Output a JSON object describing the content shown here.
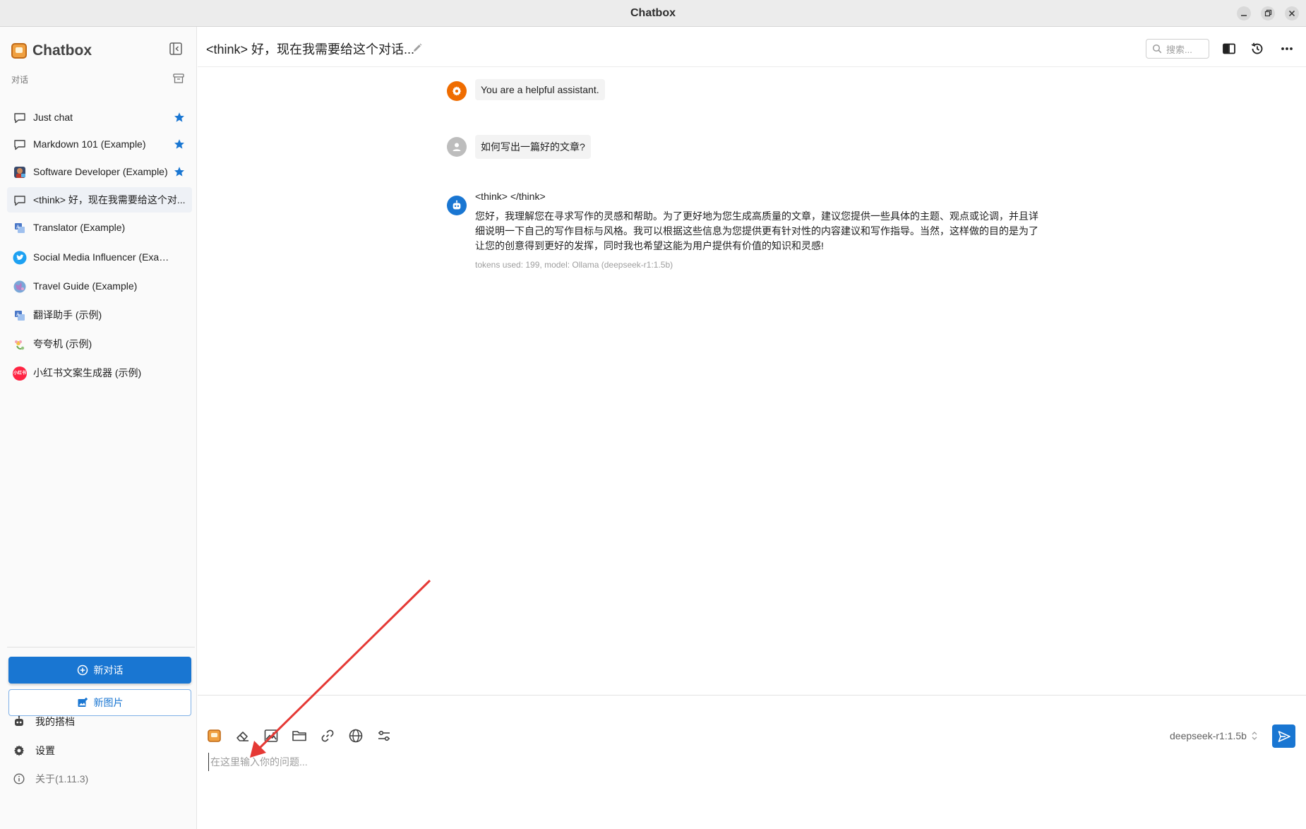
{
  "window": {
    "title": "Chatbox"
  },
  "sidebar": {
    "brand": "Chatbox",
    "section_label": "对话",
    "sessions": [
      {
        "label": "Just chat",
        "icon": "chat-bubble-icon",
        "starred": true,
        "active": false
      },
      {
        "label": "Markdown 101 (Example)",
        "icon": "chat-bubble-icon",
        "starred": true,
        "active": false
      },
      {
        "label": "Software Developer (Example)",
        "icon": "developer-avatar-icon",
        "starred": true,
        "active": false
      },
      {
        "label": "<think> 好，现在我需要给这个对...",
        "icon": "chat-bubble-icon",
        "starred": false,
        "active": true
      },
      {
        "label": "Translator (Example)",
        "icon": "translator-avatar-icon",
        "starred": false,
        "active": false
      },
      {
        "label": "Social Media Influencer (Example)",
        "icon": "twitter-avatar-icon",
        "starred": false,
        "active": false
      },
      {
        "label": "Travel Guide (Example)",
        "icon": "globe-avatar-icon",
        "starred": false,
        "active": false
      },
      {
        "label": "翻译助手 (示例)",
        "icon": "translator-avatar-icon",
        "starred": false,
        "active": false
      },
      {
        "label": "夸夸机 (示例)",
        "icon": "flower-avatar-icon",
        "starred": false,
        "active": false
      },
      {
        "label": "小红书文案生成器 (示例)",
        "icon": "xiaohongshu-avatar-icon",
        "starred": false,
        "active": false
      }
    ],
    "xhs_badge": "小红书",
    "new_chat_label": "新对话",
    "new_image_label": "新图片",
    "my_copilots_label": "我的搭档",
    "settings_label": "设置",
    "about_label": "关于(1.11.3)"
  },
  "header": {
    "chat_title": "<think> 好，现在我需要给这个对话...",
    "search_placeholder": "搜索..."
  },
  "messages": {
    "system": "You are a helpful assistant.",
    "user": "如何写出一篇好的文章?",
    "assistant_think": "<think> </think>",
    "assistant_body": "您好，我理解您在寻求写作的灵感和帮助。为了更好地为您生成高质量的文章，建议您提供一些具体的主题、观点或论调，并且详细说明一下自己的写作目标与风格。我可以根据这些信息为您提供更有针对性的内容建议和写作指导。当然，这样做的目的是为了让您的创意得到更好的发挥，同时我也希望这能为用户提供有价值的知识和灵感!",
    "assistant_meta": "tokens used: 199, model: Ollama (deepseek-r1:1.5b)"
  },
  "composer": {
    "model": "deepseek-r1:1.5b",
    "placeholder": "在这里输入你的问题..."
  },
  "colors": {
    "accent": "#1976d2",
    "star": "#1976d2",
    "system_avatar": "#ef6c00",
    "assistant_avatar": "#1976d2",
    "annotation_arrow": "#e53935"
  }
}
